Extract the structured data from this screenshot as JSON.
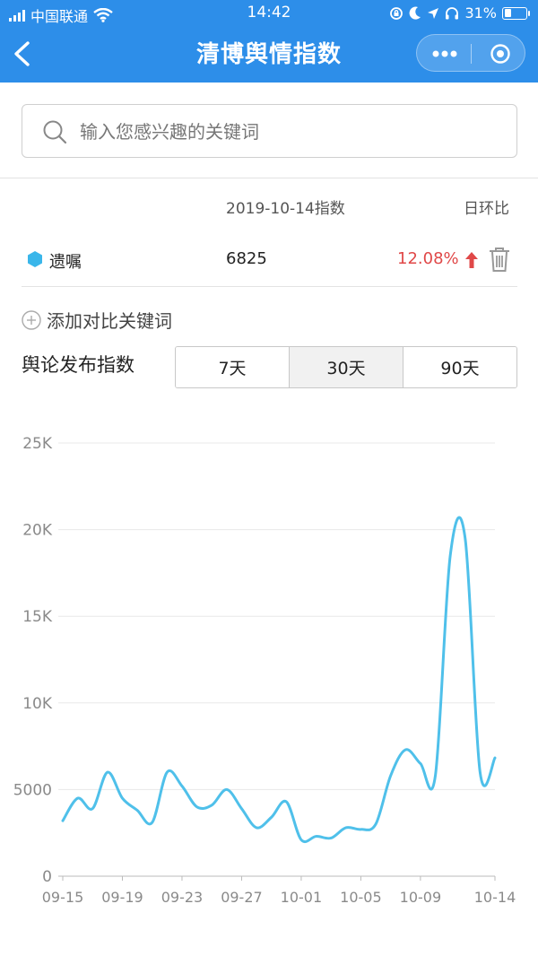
{
  "status_bar": {
    "carrier": "中国联通",
    "time": "14:42",
    "battery": "31%",
    "battery_level": 0.31
  },
  "nav": {
    "title": "清博舆情指数"
  },
  "search": {
    "placeholder": "输入您感兴趣的关键词"
  },
  "table": {
    "date_header": "2019-10-14指数",
    "ratio_header": "日环比",
    "rows": [
      {
        "keyword": "遗嘱",
        "value": "6825",
        "ratio": "12.08%"
      }
    ]
  },
  "add_compare": {
    "label": "添加对比关键词"
  },
  "range": {
    "label": "舆论发布指数",
    "options": [
      "7天",
      "30天",
      "90天"
    ],
    "selected": "30天"
  },
  "colors": {
    "nav": "#2d8ee9",
    "line": "#4fc0ea",
    "up": "#e04848"
  },
  "chart_data": {
    "type": "line",
    "ylim": [
      0,
      25000
    ],
    "y_ticks": [
      "0",
      "5000",
      "10K",
      "15K",
      "20K",
      "25K"
    ],
    "x_tick_labels": [
      "09-15",
      "09-19",
      "09-23",
      "09-27",
      "10-01",
      "10-05",
      "10-09",
      "10-14"
    ],
    "x": [
      "09-15",
      "09-16",
      "09-17",
      "09-18",
      "09-19",
      "09-20",
      "09-21",
      "09-22",
      "09-23",
      "09-24",
      "09-25",
      "09-26",
      "09-27",
      "09-28",
      "09-29",
      "09-30",
      "10-01",
      "10-02",
      "10-03",
      "10-04",
      "10-05",
      "10-06",
      "10-07",
      "10-08",
      "10-09",
      "10-10",
      "10-11",
      "10-12",
      "10-13",
      "10-14"
    ],
    "series": [
      {
        "values": [
          3200,
          4500,
          3900,
          6000,
          4500,
          3800,
          3100,
          6000,
          5200,
          4000,
          4100,
          5000,
          3900,
          2800,
          3400,
          4300,
          2100,
          2300,
          2200,
          2800,
          2700,
          3000,
          5800,
          7300,
          6500,
          5800,
          18500,
          19500,
          6000,
          6825
        ]
      }
    ]
  }
}
